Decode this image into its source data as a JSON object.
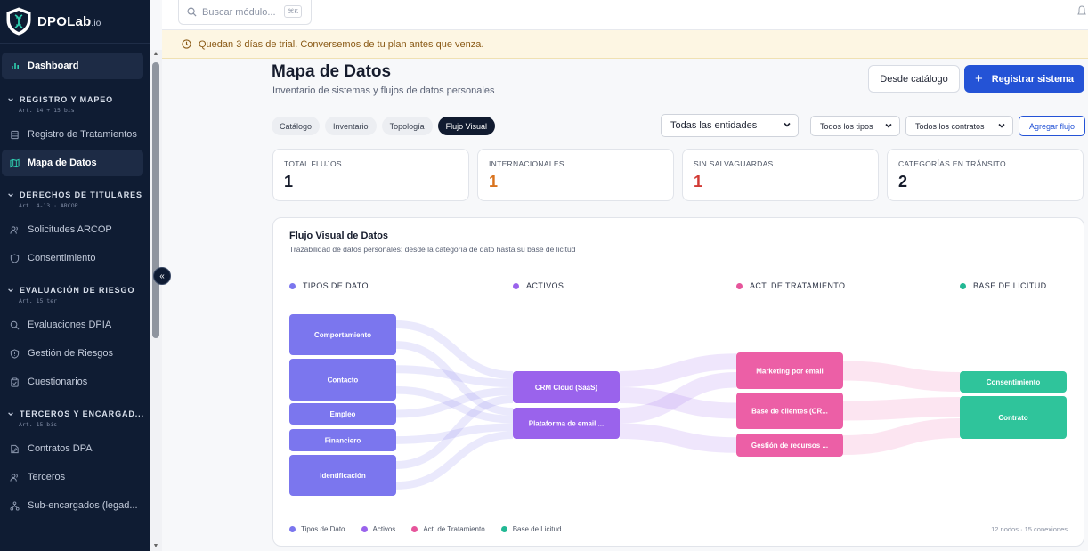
{
  "brand": {
    "name": "DPOLab",
    "suffix": ".io"
  },
  "sidebar": {
    "dashboard": "Dashboard",
    "sections": [
      {
        "title": "REGISTRO Y MAPEO",
        "sub": "Art. 14 + 15 bis",
        "items": [
          {
            "label": "Registro de Tratamientos",
            "icon": "database-icon"
          },
          {
            "label": "Mapa de Datos",
            "icon": "map-icon",
            "active": true
          }
        ]
      },
      {
        "title": "DERECHOS DE TITULARES",
        "sub": "Art. 4-13 · ARCOP",
        "items": [
          {
            "label": "Solicitudes ARCOP",
            "icon": "users-icon"
          },
          {
            "label": "Consentimiento",
            "icon": "shield-icon"
          }
        ]
      },
      {
        "title": "EVALUACIÓN DE RIESGO",
        "sub": "Art. 15 ter",
        "items": [
          {
            "label": "Evaluaciones DPIA",
            "icon": "search-icon"
          },
          {
            "label": "Gestión de Riesgos",
            "icon": "shield-alert-icon"
          },
          {
            "label": "Cuestionarios",
            "icon": "clipboard-icon"
          }
        ]
      },
      {
        "title": "TERCEROS Y ENCARGAD...",
        "sub": "Art. 15 bis",
        "items": [
          {
            "label": "Contratos DPA",
            "icon": "file-edit-icon"
          },
          {
            "label": "Terceros",
            "icon": "users-icon"
          },
          {
            "label": "Sub-encargados (legad...",
            "icon": "network-icon"
          }
        ]
      }
    ]
  },
  "search": {
    "placeholder": "Buscar módulo...",
    "shortcut": "⌘K"
  },
  "trial_banner": "Quedan 3 días de trial. Conversemos de tu plan antes que venza.",
  "header": {
    "title": "Mapa de Datos",
    "subtitle": "Inventario de sistemas y flujos de datos personales",
    "btn_catalog": "Desde catálogo",
    "btn_register": "Registrar sistema"
  },
  "tabs": [
    {
      "label": "Catálogo"
    },
    {
      "label": "Inventario"
    },
    {
      "label": "Topología"
    },
    {
      "label": "Flujo Visual",
      "active": true
    }
  ],
  "filters": {
    "entities": "Todas las entidades",
    "types": "Todos los tipos",
    "contracts": "Todos los contratos",
    "add_flow": "Agregar flujo"
  },
  "stats": [
    {
      "label": "TOTAL FLUJOS",
      "value": "1",
      "color": "#141a2a"
    },
    {
      "label": "INTERNACIONALES",
      "value": "1",
      "color": "#d9731e"
    },
    {
      "label": "SIN SALVAGUARDAS",
      "value": "1",
      "color": "#d23a35"
    },
    {
      "label": "CATEGORÍAS EN TRÁNSITO",
      "value": "2",
      "color": "#141a2a"
    }
  ],
  "flow_card": {
    "title": "Flujo Visual de Datos",
    "subtitle": "Trazabilidad de datos personales: desde la categoría de dato hasta su base de licitud",
    "columns": [
      {
        "label": "TIPOS DE DATO",
        "color": "#7b76ee"
      },
      {
        "label": "ACTIVOS",
        "color": "#9a63ec"
      },
      {
        "label": "ACT. DE TRATAMIENTO",
        "color": "#e6559b"
      },
      {
        "label": "BASE DE LICITUD",
        "color": "#22b894"
      }
    ],
    "legend": [
      {
        "label": "Tipos de Dato",
        "color": "#7b76ee"
      },
      {
        "label": "Activos",
        "color": "#9a63ec"
      },
      {
        "label": "Act. de Tratamiento",
        "color": "#e6559b"
      },
      {
        "label": "Base de Licitud",
        "color": "#22b894"
      }
    ],
    "footnote": "12 nodos · 15 conexiones",
    "nodes": [
      {
        "id": "comportamiento",
        "label": "Comportamiento",
        "col": 0,
        "color": "#7b76ee"
      },
      {
        "id": "contacto",
        "label": "Contacto",
        "col": 0,
        "color": "#7b76ee"
      },
      {
        "id": "empleo",
        "label": "Empleo",
        "col": 0,
        "color": "#7b76ee"
      },
      {
        "id": "financiero",
        "label": "Financiero",
        "col": 0,
        "color": "#7b76ee"
      },
      {
        "id": "identificacion",
        "label": "Identificación",
        "col": 0,
        "color": "#7b76ee"
      },
      {
        "id": "crm",
        "label": "CRM Cloud (SaaS)",
        "col": 1,
        "color": "#9a63ec"
      },
      {
        "id": "email",
        "label": "Plataforma de email ...",
        "col": 1,
        "color": "#9a63ec"
      },
      {
        "id": "marketing",
        "label": "Marketing por email",
        "col": 2,
        "color": "#ec5fa6"
      },
      {
        "id": "clientes",
        "label": "Base de clientes (CR...",
        "col": 2,
        "color": "#ec5fa6"
      },
      {
        "id": "recursos",
        "label": "Gestión de recursos ...",
        "col": 2,
        "color": "#ec5fa6"
      },
      {
        "id": "consentimiento",
        "label": "Consentimiento",
        "col": 3,
        "color": "#2fc49b"
      },
      {
        "id": "contrato",
        "label": "Contrato",
        "col": 3,
        "color": "#2fc49b"
      }
    ],
    "links": [
      {
        "from": "comportamiento",
        "to": "crm"
      },
      {
        "from": "comportamiento",
        "to": "email"
      },
      {
        "from": "contacto",
        "to": "crm"
      },
      {
        "from": "contacto",
        "to": "email"
      },
      {
        "from": "empleo",
        "to": "crm"
      },
      {
        "from": "financiero",
        "to": "email"
      },
      {
        "from": "identificacion",
        "to": "crm"
      },
      {
        "from": "identificacion",
        "to": "email"
      },
      {
        "from": "crm",
        "to": "marketing"
      },
      {
        "from": "crm",
        "to": "clientes"
      },
      {
        "from": "email",
        "to": "marketing"
      },
      {
        "from": "email",
        "to": "recursos"
      },
      {
        "from": "marketing",
        "to": "consentimiento"
      },
      {
        "from": "clientes",
        "to": "contrato"
      },
      {
        "from": "recursos",
        "to": "contrato"
      }
    ]
  }
}
